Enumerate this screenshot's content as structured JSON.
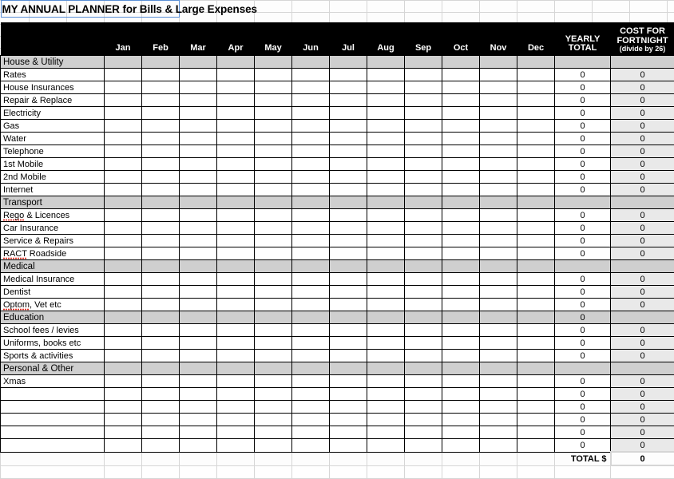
{
  "document": {
    "title": "MY ANNUAL PLANNER for Bills & Large Expenses",
    "selected_cell_outline_color": "#5a8fd6"
  },
  "colors": {
    "header_background": "#000000",
    "header_text": "#ffffff",
    "section_row_background": "#cfcfcf",
    "fortnight_column_background": "#e9e9e9",
    "grid_line": "#000000",
    "sheet_grid_line": "#d6d6d6",
    "spellcheck_underline": "#e02b1e"
  },
  "table": {
    "row_label_header": "",
    "month_headers": [
      "Jan",
      "Feb",
      "Mar",
      "Apr",
      "May",
      "Jun",
      "Jul",
      "Aug",
      "Sep",
      "Oct",
      "Nov",
      "Dec"
    ],
    "yearly_total_header": "YEARLY TOTAL",
    "yearly_total_header_line1": "YEARLY",
    "yearly_total_header_line2": "TOTAL",
    "fortnight_header_line1": "COST FOR",
    "fortnight_header_line2": "FORTNIGHT",
    "fortnight_header_line3": "(divide by 26)",
    "zero_value": "0",
    "total_label": "TOTAL $",
    "total_value": "0",
    "rows": [
      {
        "type": "section",
        "label": "House & Utility",
        "yearly": "",
        "fortnight": ""
      },
      {
        "type": "item",
        "label": "Rates",
        "yearly": "0",
        "fortnight": "0"
      },
      {
        "type": "item",
        "label": "House Insurances",
        "yearly": "0",
        "fortnight": "0"
      },
      {
        "type": "item",
        "label": "Repair & Replace",
        "yearly": "0",
        "fortnight": "0"
      },
      {
        "type": "item",
        "label": "Electricity",
        "yearly": "0",
        "fortnight": "0"
      },
      {
        "type": "item",
        "label": "Gas",
        "yearly": "0",
        "fortnight": "0"
      },
      {
        "type": "item",
        "label": "Water",
        "yearly": "0",
        "fortnight": "0"
      },
      {
        "type": "item",
        "label": "Telephone",
        "yearly": "0",
        "fortnight": "0"
      },
      {
        "type": "item",
        "label": "1st Mobile",
        "yearly": "0",
        "fortnight": "0"
      },
      {
        "type": "item",
        "label": "2nd Mobile",
        "yearly": "0",
        "fortnight": "0"
      },
      {
        "type": "item",
        "label": "Internet",
        "yearly": "0",
        "fortnight": "0"
      },
      {
        "type": "section",
        "label": "Transport",
        "yearly": "",
        "fortnight": ""
      },
      {
        "type": "item",
        "label": "Rego & Licences",
        "yearly": "0",
        "fortnight": "0",
        "misspelled": "Rego"
      },
      {
        "type": "item",
        "label": "Car Insurance",
        "yearly": "0",
        "fortnight": "0"
      },
      {
        "type": "item",
        "label": "Service & Repairs",
        "yearly": "0",
        "fortnight": "0"
      },
      {
        "type": "item",
        "label": "RACT Roadside",
        "yearly": "0",
        "fortnight": "0",
        "misspelled": "RACT"
      },
      {
        "type": "section",
        "label": "Medical",
        "yearly": "",
        "fortnight": ""
      },
      {
        "type": "item",
        "label": "Medical  Insurance",
        "yearly": "0",
        "fortnight": "0"
      },
      {
        "type": "item",
        "label": "Dentist",
        "yearly": "0",
        "fortnight": "0"
      },
      {
        "type": "item",
        "label": "Optom, Vet etc",
        "yearly": "0",
        "fortnight": "0",
        "misspelled": "Optom"
      },
      {
        "type": "section",
        "label": "Education",
        "yearly": "0",
        "fortnight": ""
      },
      {
        "type": "item",
        "label": "School fees / levies",
        "yearly": "0",
        "fortnight": "0"
      },
      {
        "type": "item",
        "label": "Uniforms, books etc",
        "yearly": "0",
        "fortnight": "0"
      },
      {
        "type": "item",
        "label": "Sports & activities",
        "yearly": "0",
        "fortnight": "0"
      },
      {
        "type": "section",
        "label": "Personal & Other",
        "yearly": "",
        "fortnight": ""
      },
      {
        "type": "item",
        "label": "Xmas",
        "yearly": "0",
        "fortnight": "0"
      },
      {
        "type": "item",
        "label": "",
        "yearly": "0",
        "fortnight": "0"
      },
      {
        "type": "item",
        "label": "",
        "yearly": "0",
        "fortnight": "0"
      },
      {
        "type": "item",
        "label": "",
        "yearly": "0",
        "fortnight": "0"
      },
      {
        "type": "item",
        "label": "",
        "yearly": "0",
        "fortnight": "0"
      },
      {
        "type": "item",
        "label": "",
        "yearly": "0",
        "fortnight": "0"
      }
    ]
  }
}
